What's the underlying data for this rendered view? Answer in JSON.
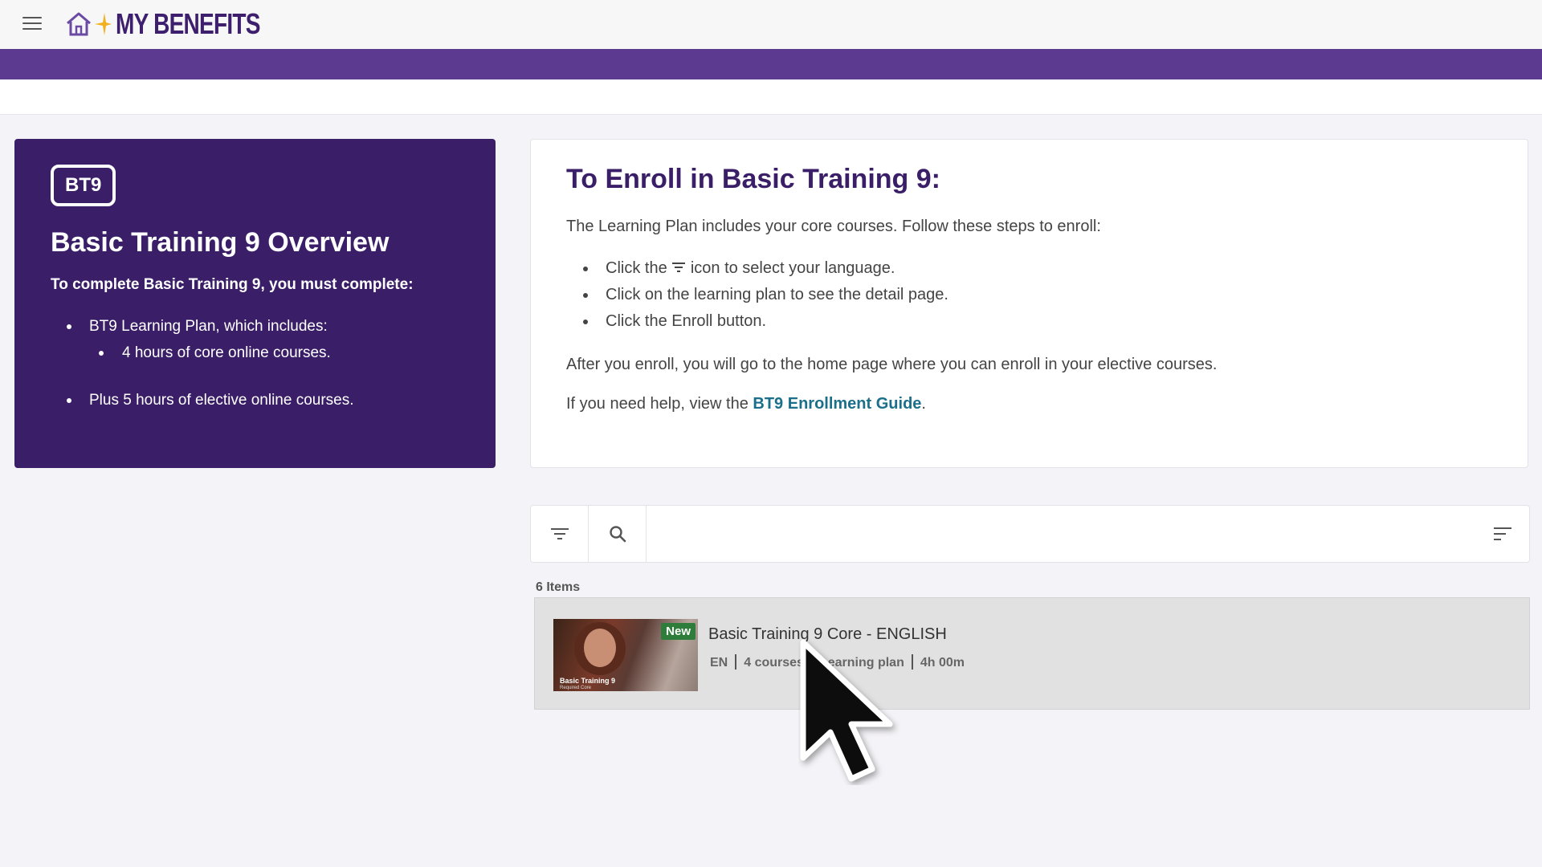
{
  "app": {
    "logo_text": "MY BENEFITS",
    "brand_color": "#3a1f68",
    "accent_color": "#5c3a8f"
  },
  "overview": {
    "badge": "BT9",
    "title": "Basic Training 9 Overview",
    "lead": "To complete Basic Training 9, you must complete:",
    "items": [
      "BT9 Learning Plan, which includes:",
      "4 hours of core online courses.",
      "Plus 5 hours of elective online courses."
    ]
  },
  "enroll": {
    "title": "To Enroll in Basic Training 9:",
    "intro": "The Learning Plan includes your core courses. Follow these steps to enroll:",
    "step1_before": "Click the",
    "step1_after": "icon to select your language.",
    "step2": "Click on the learning plan to see the detail page.",
    "step3": "Click the Enroll button.",
    "after": "After you enroll, you will go to the home page where you can enroll in your elective courses.",
    "help_before": "If you need help, view the",
    "help_link": "BT9 Enrollment Guide",
    "help_after": "."
  },
  "catalog": {
    "items_count": "6 Items",
    "items": [
      {
        "title": "Basic Training 9 Core - ENGLISH",
        "badge": "New",
        "thumb_caption": "Basic Training 9",
        "thumb_subcaption": "Required Core",
        "language": "EN",
        "courses": "4 courses",
        "type": "Learning plan",
        "duration": "4h 00m"
      }
    ]
  }
}
